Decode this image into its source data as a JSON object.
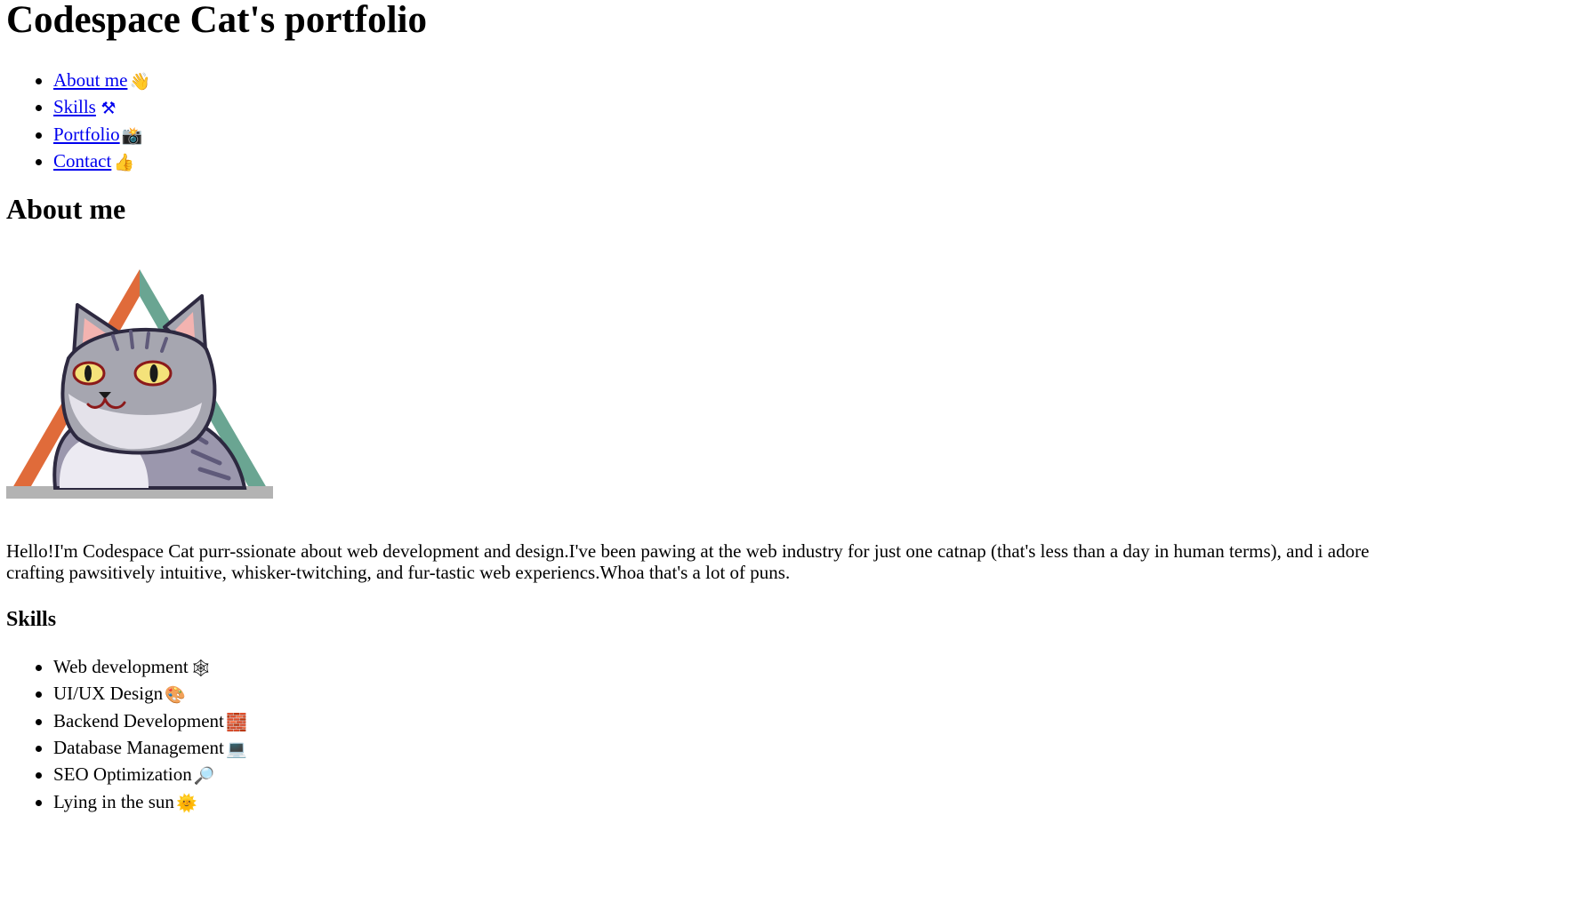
{
  "header": {
    "title": "Codespace Cat's portfolio"
  },
  "nav": {
    "items": [
      {
        "label": "About me",
        "emoji": "👋",
        "icon": "waving-hand-icon"
      },
      {
        "label": "Skills",
        "emoji": "⚒",
        "icon": "hammer-pick-icon"
      },
      {
        "label": "Portfolio",
        "emoji": "📸",
        "icon": "camera-icon"
      },
      {
        "label": "Contact",
        "emoji": "👍",
        "icon": "thumbs-up-icon"
      }
    ]
  },
  "about": {
    "heading": "About me",
    "image_alt": "Codespace Cat avatar in triangle",
    "intro": "Hello!I'm Codespace Cat purr-ssionate about web development and design.I've been pawing at the web industry for just one catnap (that's less than a day in human terms), and i adore crafting pawsitively intuitive, whisker-twitching, and fur-tastic web experiencs.Whoa that's a lot of puns."
  },
  "skills": {
    "heading": "Skills",
    "items": [
      {
        "label": "Web development",
        "emoji": "🕸",
        "icon": "spider-web-icon"
      },
      {
        "label": "UI/UX Design",
        "emoji": "🎨",
        "icon": "palette-icon"
      },
      {
        "label": "Backend Development",
        "emoji": "🧱",
        "icon": "brick-icon"
      },
      {
        "label": "Database Management",
        "emoji": "💻",
        "icon": "laptop-icon"
      },
      {
        "label": "SEO Optimization",
        "emoji": "🔎",
        "icon": "magnifier-icon"
      },
      {
        "label": "Lying in the sun",
        "emoji": "🌞",
        "icon": "sun-icon"
      }
    ]
  },
  "colors": {
    "link": "#0000ee",
    "triangle_left": "#e06b3a",
    "triangle_right": "#6aa592",
    "triangle_base": "#b3b3b3",
    "cat_fur": "#a6a6b0",
    "cat_eye": "#f4e27a"
  }
}
